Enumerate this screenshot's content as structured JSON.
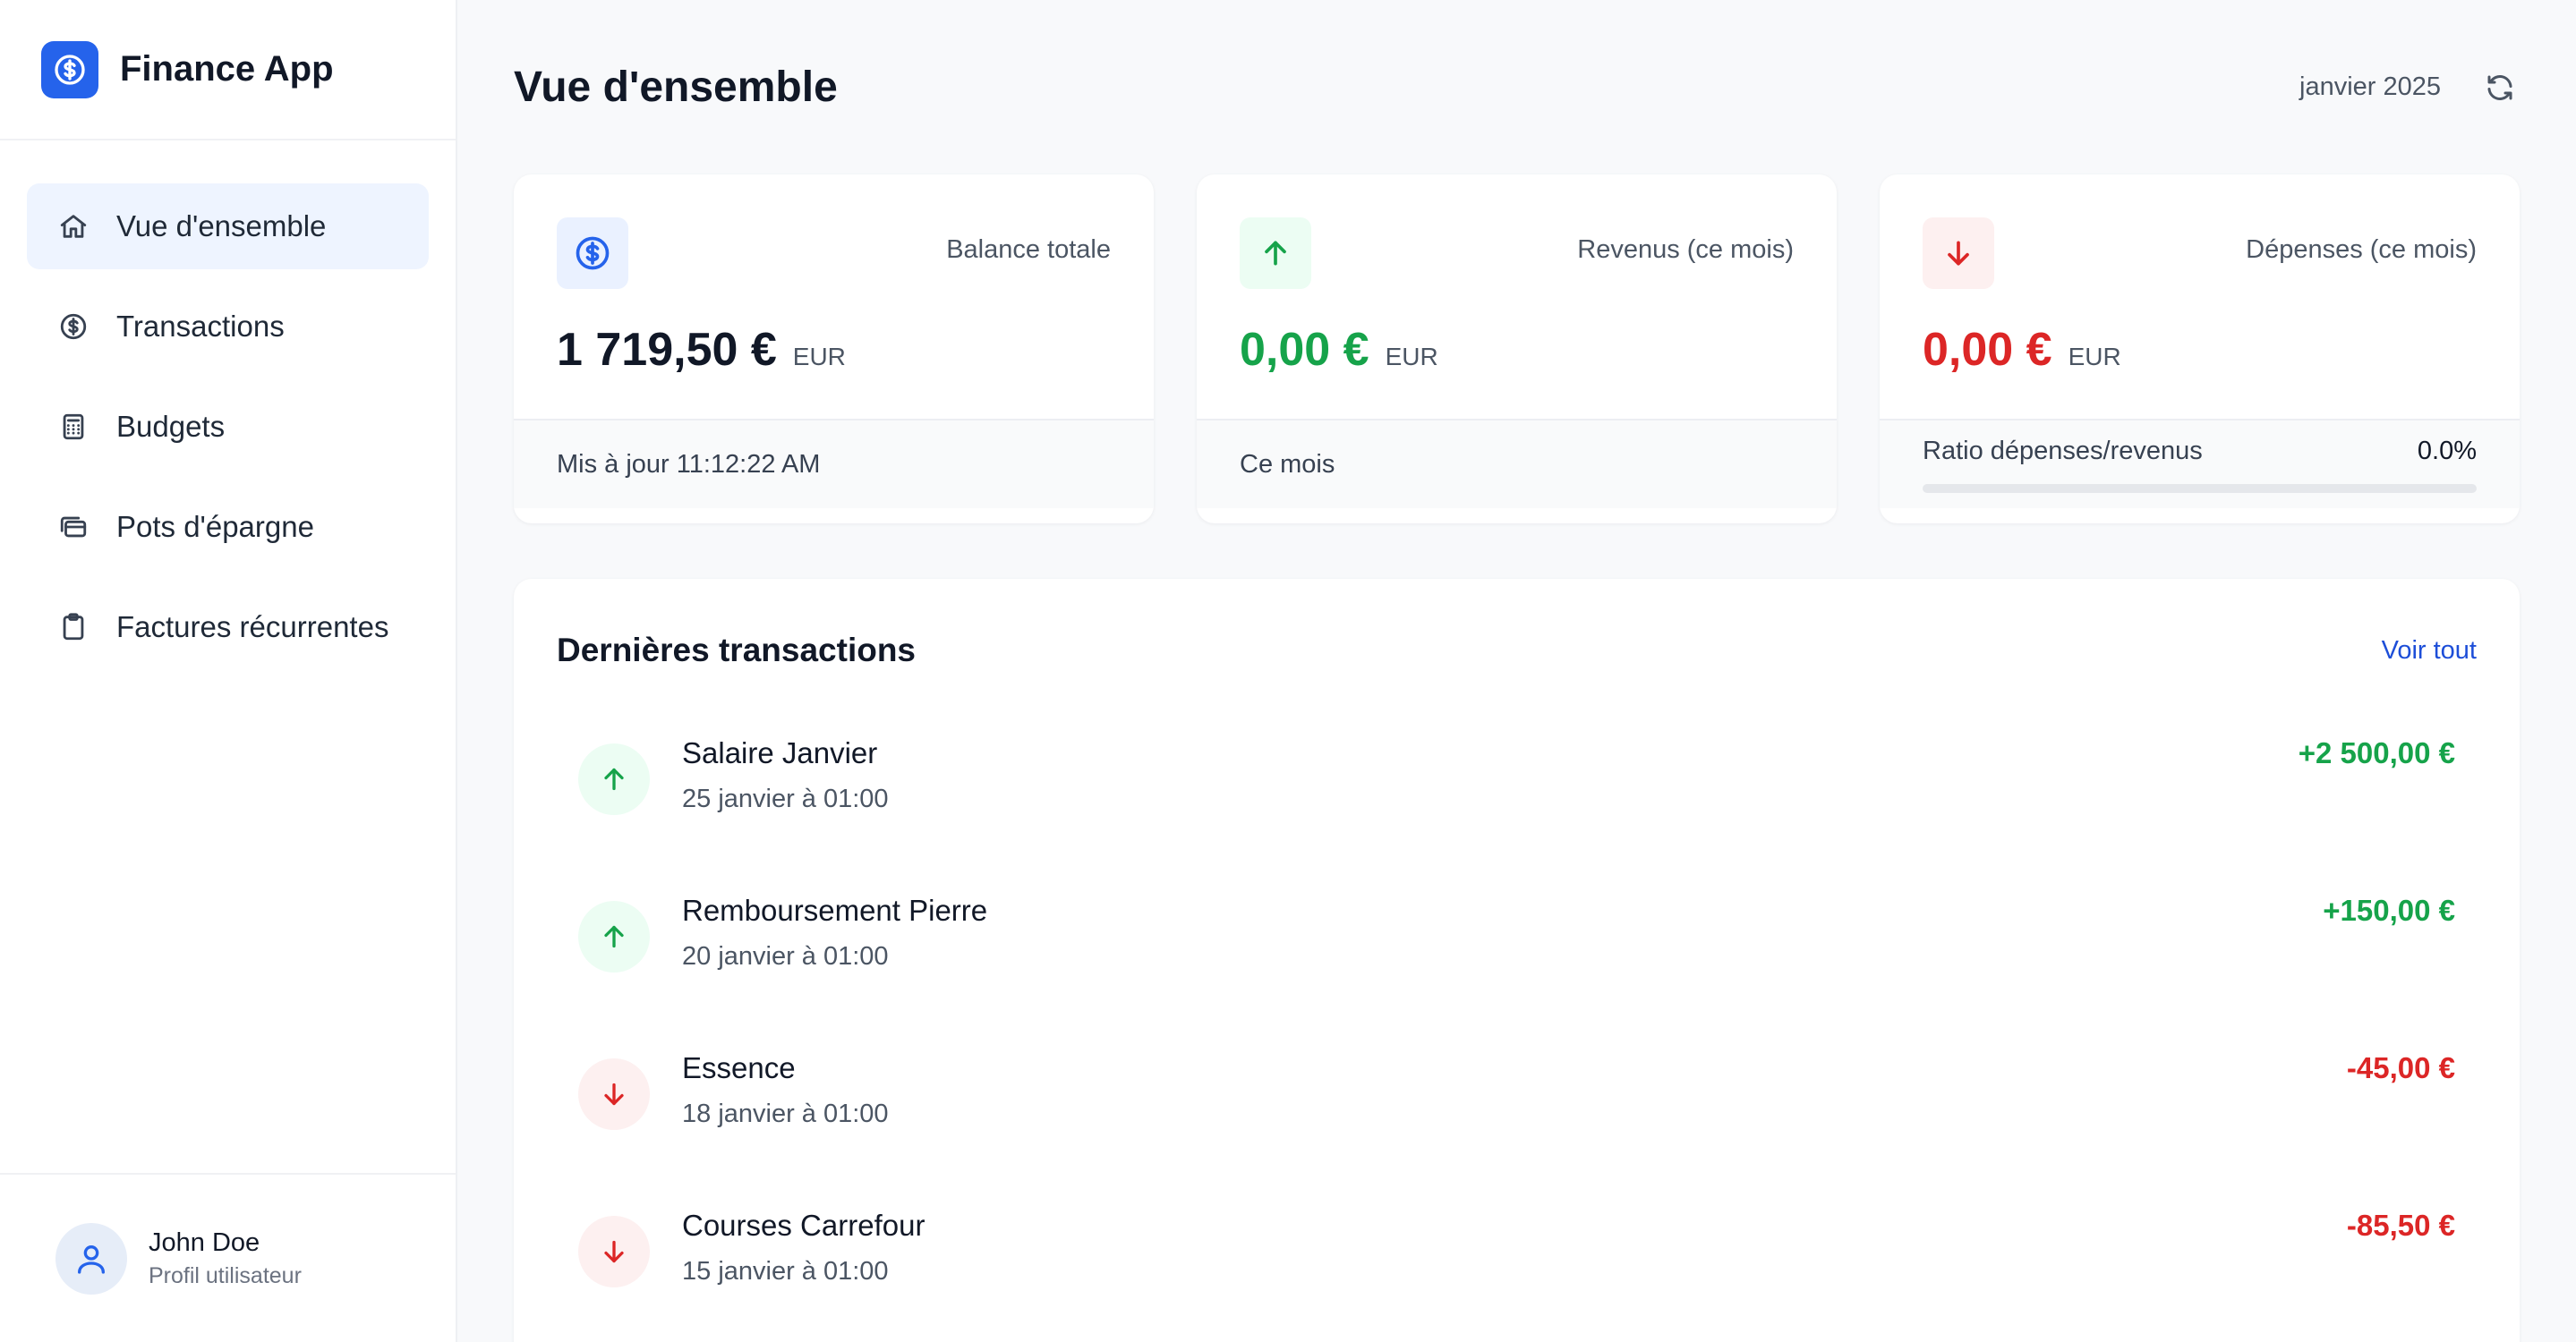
{
  "brand": {
    "title": "Finance App",
    "logo_icon": "dollar-circle-icon",
    "accent": "#2563eb"
  },
  "nav": {
    "items": [
      {
        "label": "Vue d'ensemble",
        "icon": "home-icon",
        "active": true
      },
      {
        "label": "Transactions",
        "icon": "dollar-circle-icon",
        "active": false
      },
      {
        "label": "Budgets",
        "icon": "calculator-icon",
        "active": false
      },
      {
        "label": "Pots d'épargne",
        "icon": "wallet-icon",
        "active": false
      },
      {
        "label": "Factures récurrentes",
        "icon": "clipboard-icon",
        "active": false
      }
    ]
  },
  "profile": {
    "name": "John Doe",
    "subtitle": "Profil utilisateur",
    "icon": "user-icon"
  },
  "header": {
    "title": "Vue d'ensemble",
    "period": "janvier 2025",
    "refresh_icon": "refresh-icon"
  },
  "cards": {
    "balance": {
      "label": "Balance totale",
      "amount": "1 719,50 €",
      "currency": "EUR",
      "footer": "Mis à jour 11:12:22 AM",
      "icon": "dollar-circle-icon"
    },
    "income": {
      "label": "Revenus (ce mois)",
      "amount": "0,00 €",
      "currency": "EUR",
      "footer": "Ce mois",
      "icon": "arrow-up-icon",
      "color": "#16a34a"
    },
    "expenses": {
      "label": "Dépenses (ce mois)",
      "amount": "0,00 €",
      "currency": "EUR",
      "ratio_label": "Ratio dépenses/revenus",
      "ratio_value": "0.0%",
      "ratio_fraction": 0.0,
      "icon": "arrow-down-icon",
      "color": "#dc2626"
    }
  },
  "transactions": {
    "title": "Dernières transactions",
    "see_all": "Voir tout",
    "items": [
      {
        "name": "Salaire Janvier",
        "date": "25 janvier à 01:00",
        "amount": "+2 500,00 €",
        "direction": "in"
      },
      {
        "name": "Remboursement Pierre",
        "date": "20 janvier à 01:00",
        "amount": "+150,00 €",
        "direction": "in"
      },
      {
        "name": "Essence",
        "date": "18 janvier à 01:00",
        "amount": "-45,00 €",
        "direction": "out"
      },
      {
        "name": "Courses Carrefour",
        "date": "15 janvier à 01:00",
        "amount": "-85,50 €",
        "direction": "out"
      }
    ]
  }
}
